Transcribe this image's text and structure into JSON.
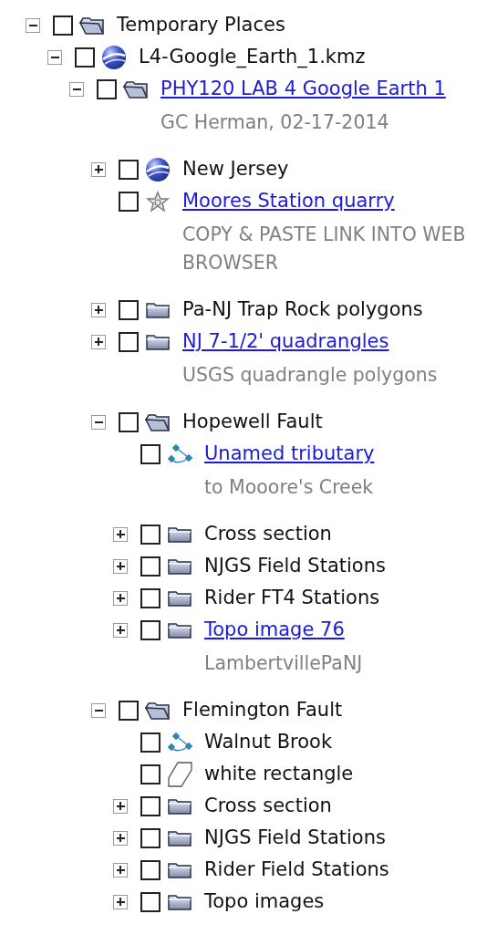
{
  "tree": [
    {
      "kind": "folder-open",
      "label": "Temporary Places",
      "link": false,
      "checked": false,
      "expanded": true,
      "children": [
        {
          "kind": "globe",
          "label": "L4-Google_Earth_1.kmz",
          "link": false,
          "checked": false,
          "expanded": true,
          "children": [
            {
              "kind": "folder-open",
              "label": "PHY120 LAB 4 Google Earth 1",
              "link": true,
              "checked": false,
              "expanded": true,
              "description": "GC Herman, 02-17-2014",
              "children": [
                {
                  "kind": "globe",
                  "label": "New Jersey",
                  "link": false,
                  "checked": false,
                  "expanded": false
                },
                {
                  "kind": "placemark",
                  "label": "Moores Station quarry",
                  "link": true,
                  "checked": false,
                  "description": "COPY & PASTE LINK INTO WEB BROWSER"
                },
                {
                  "kind": "folder",
                  "label": "Pa-NJ Trap Rock polygons",
                  "link": false,
                  "checked": false,
                  "expanded": false
                },
                {
                  "kind": "folder",
                  "label": "NJ 7-1/2' quadrangles",
                  "link": true,
                  "checked": false,
                  "expanded": false,
                  "description": "USGS quadrangle polygons"
                },
                {
                  "kind": "folder-open",
                  "label": "Hopewell Fault",
                  "link": false,
                  "checked": false,
                  "expanded": true,
                  "children": [
                    {
                      "kind": "path",
                      "label": "Unamed tributary",
                      "link": true,
                      "checked": false,
                      "description": "to Mooore's Creek"
                    },
                    {
                      "kind": "folder",
                      "label": "Cross section",
                      "link": false,
                      "checked": false,
                      "expanded": false
                    },
                    {
                      "kind": "folder",
                      "label": "NJGS Field Stations",
                      "link": false,
                      "checked": false,
                      "expanded": false
                    },
                    {
                      "kind": "folder",
                      "label": "Rider FT4 Stations",
                      "link": false,
                      "checked": false,
                      "expanded": false
                    },
                    {
                      "kind": "folder",
                      "label": "Topo image 76",
                      "link": true,
                      "checked": false,
                      "expanded": false,
                      "description": "LambertvillePaNJ"
                    }
                  ]
                },
                {
                  "kind": "folder-open",
                  "label": "Flemington Fault",
                  "link": false,
                  "checked": false,
                  "expanded": true,
                  "children": [
                    {
                      "kind": "path",
                      "label": "Walnut Brook",
                      "link": false,
                      "checked": false
                    },
                    {
                      "kind": "polygon",
                      "label": "white rectangle",
                      "link": false,
                      "checked": false
                    },
                    {
                      "kind": "folder",
                      "label": "Cross section",
                      "link": false,
                      "checked": false,
                      "expanded": false
                    },
                    {
                      "kind": "folder",
                      "label": "NJGS Field Stations",
                      "link": false,
                      "checked": false,
                      "expanded": false
                    },
                    {
                      "kind": "folder",
                      "label": "Rider Field Stations",
                      "link": false,
                      "checked": false,
                      "expanded": false
                    },
                    {
                      "kind": "folder",
                      "label": "Topo images",
                      "link": false,
                      "checked": false,
                      "expanded": false
                    }
                  ]
                }
              ]
            }
          ]
        }
      ]
    }
  ]
}
